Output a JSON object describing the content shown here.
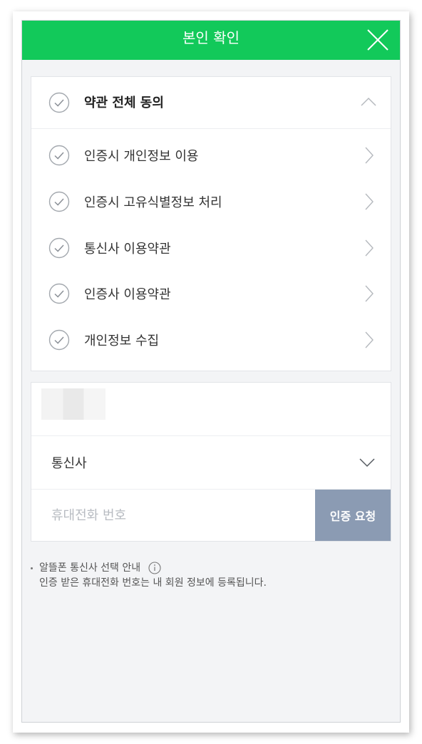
{
  "header": {
    "title": "본인 확인",
    "close_icon": "close-icon"
  },
  "terms": {
    "all_label": "약관 전체 동의",
    "items": [
      {
        "label": "인증시 개인정보 이용"
      },
      {
        "label": "인증시 고유식별정보 처리"
      },
      {
        "label": "통신사 이용약관"
      },
      {
        "label": "인증사 이용약관"
      },
      {
        "label": "개인정보 수집"
      }
    ]
  },
  "form": {
    "carrier_label": "통신사",
    "phone_placeholder": "휴대전화 번호",
    "verify_button": "인증 요청"
  },
  "notice": {
    "line1": "알뜰폰 통신사 선택 안내",
    "line2": "인증 받은 휴대전화 번호는 내 회원 정보에 등록됩니다."
  },
  "colors": {
    "brand_green": "#12c95a",
    "button_gray_blue": "#8b9bb3",
    "background": "#f3f4f6"
  }
}
